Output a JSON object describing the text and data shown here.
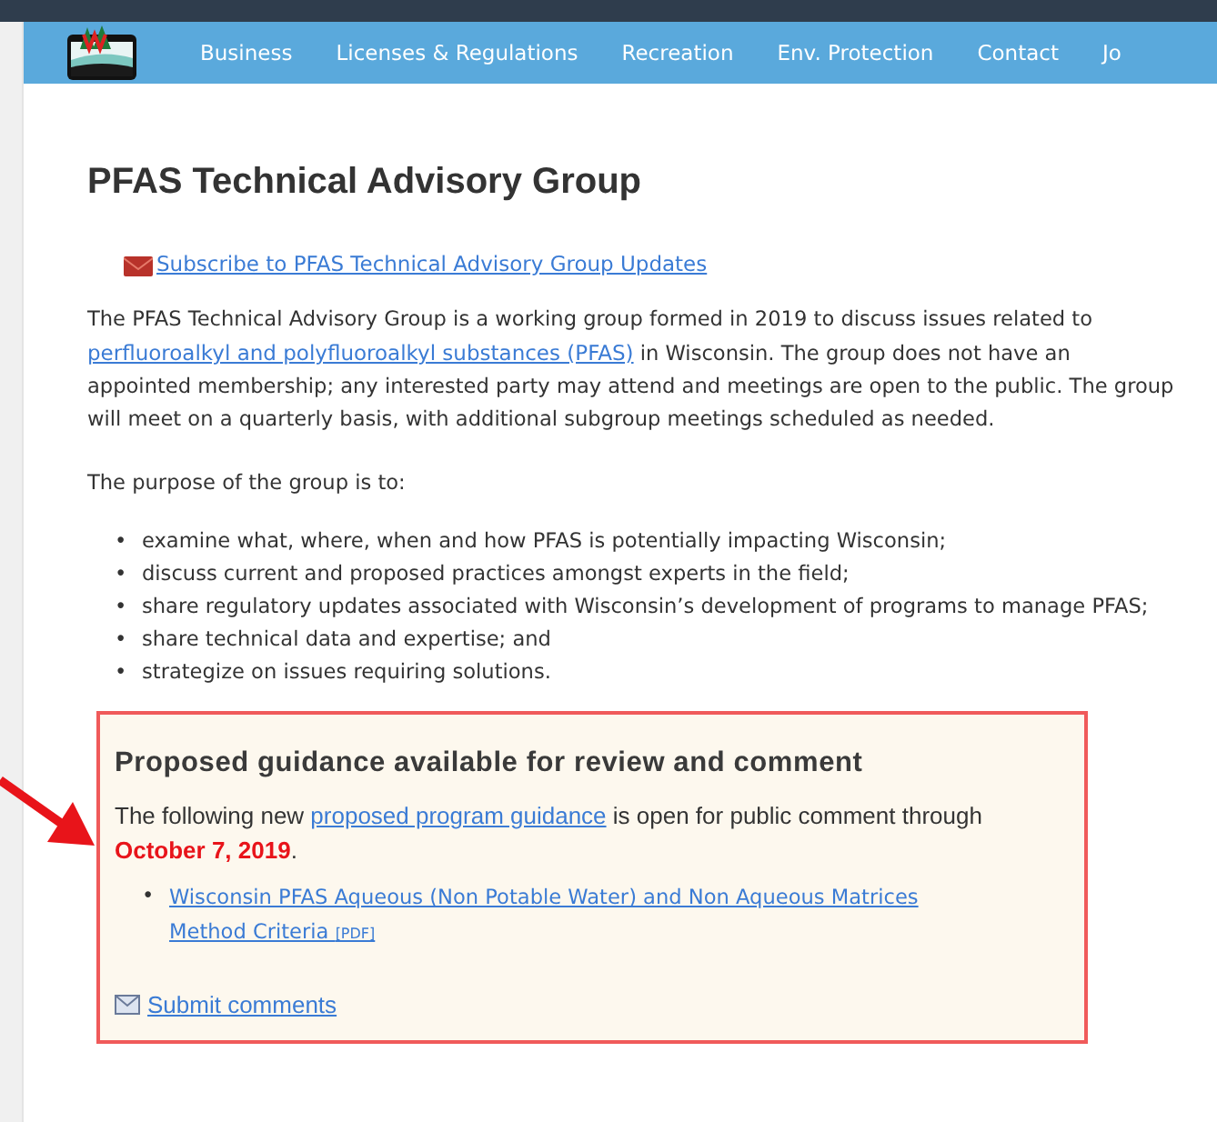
{
  "nav": {
    "items": [
      {
        "label": "Business"
      },
      {
        "label": "Licenses & Regulations"
      },
      {
        "label": "Recreation"
      },
      {
        "label": "Env. Protection"
      },
      {
        "label": "Contact"
      },
      {
        "label": "Jo"
      }
    ]
  },
  "title": "PFAS Technical Advisory Group",
  "subscribe_link": "Subscribe to PFAS Technical Advisory Group Updates",
  "intro": {
    "before": "The PFAS Technical Advisory Group is a working group formed in 2019 to discuss issues related to ",
    "link": "perfluoroalkyl and polyfluoroalkyl substances (PFAS)",
    "after": " in Wisconsin. The group does not have an appointed membership; any interested party may attend and meetings are open to the public. The group will meet on a quarterly basis, with additional subgroup meetings scheduled as needed."
  },
  "purpose_lead": "The purpose of the group is to:",
  "purposes": [
    {
      "marker": "•",
      "text": "examine what, where, when and how PFAS is potentially impacting Wisconsin;"
    },
    {
      "marker": "•",
      "text": "discuss current and proposed practices amongst experts in the field;"
    },
    {
      "marker": "•",
      "text": "share regulatory updates associated with Wisconsin’s development of programs to manage PFAS;"
    },
    {
      "marker": "•",
      "text": "share technical data and expertise; and"
    },
    {
      "marker": "•",
      "text": "strategize on issues requiring solutions."
    }
  ],
  "notice": {
    "heading": "Proposed guidance available for review and comment",
    "before": "The following new ",
    "link": "proposed program guidance",
    "middle": " is open for public comment through ",
    "deadline": "October 7, 2019",
    "after": ".",
    "documents": [
      {
        "marker": "•",
        "label": "Wisconsin PFAS Aqueous (Non Potable Water) and Non Aqueous Matrices Method Criteria",
        "tag": "[PDF]"
      }
    ],
    "submit_link": "Submit comments"
  }
}
